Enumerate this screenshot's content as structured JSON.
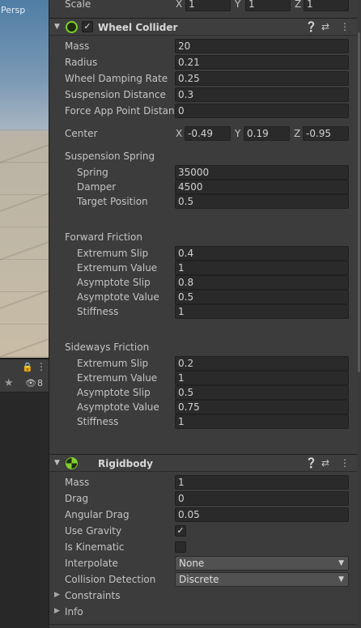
{
  "scene": {
    "view_label": "Persp"
  },
  "left_panel": {
    "visible_count": "8"
  },
  "transform": {
    "scale_label": "Scale",
    "scale": {
      "x_label": "X",
      "x": "1",
      "y_label": "Y",
      "y": "1",
      "z_label": "Z",
      "z": "1"
    }
  },
  "wheel_collider": {
    "title": "Wheel Collider",
    "enabled": true,
    "mass": {
      "label": "Mass",
      "value": "20"
    },
    "radius": {
      "label": "Radius",
      "value": "0.21"
    },
    "wheel_damping_rate": {
      "label": "Wheel Damping Rate",
      "value": "0.25"
    },
    "suspension_distance": {
      "label": "Suspension Distance",
      "value": "0.3"
    },
    "force_app_point_distance": {
      "label": "Force App Point Distanc",
      "value": "0"
    },
    "center": {
      "label": "Center",
      "x_label": "X",
      "x": "-0.49",
      "y_label": "Y",
      "y": "0.19",
      "z_label": "Z",
      "z": "-0.95"
    },
    "suspension_spring": {
      "label": "Suspension Spring",
      "spring": {
        "label": "Spring",
        "value": "35000"
      },
      "damper": {
        "label": "Damper",
        "value": "4500"
      },
      "target_position": {
        "label": "Target Position",
        "value": "0.5"
      }
    },
    "forward_friction": {
      "label": "Forward Friction",
      "extremum_slip": {
        "label": "Extremum Slip",
        "value": "0.4"
      },
      "extremum_value": {
        "label": "Extremum Value",
        "value": "1"
      },
      "asymptote_slip": {
        "label": "Asymptote Slip",
        "value": "0.8"
      },
      "asymptote_value": {
        "label": "Asymptote Value",
        "value": "0.5"
      },
      "stiffness": {
        "label": "Stiffness",
        "value": "1"
      }
    },
    "sideways_friction": {
      "label": "Sideways Friction",
      "extremum_slip": {
        "label": "Extremum Slip",
        "value": "0.2"
      },
      "extremum_value": {
        "label": "Extremum Value",
        "value": "1"
      },
      "asymptote_slip": {
        "label": "Asymptote Slip",
        "value": "0.5"
      },
      "asymptote_value": {
        "label": "Asymptote Value",
        "value": "0.75"
      },
      "stiffness": {
        "label": "Stiffness",
        "value": "1"
      }
    }
  },
  "rigidbody": {
    "title": "Rigidbody",
    "mass": {
      "label": "Mass",
      "value": "1"
    },
    "drag": {
      "label": "Drag",
      "value": "0"
    },
    "angular_drag": {
      "label": "Angular Drag",
      "value": "0.05"
    },
    "use_gravity": {
      "label": "Use Gravity",
      "checked": true
    },
    "is_kinematic": {
      "label": "Is Kinematic",
      "checked": false
    },
    "interpolate": {
      "label": "Interpolate",
      "value": "None"
    },
    "collision_detection": {
      "label": "Collision Detection",
      "value": "Discrete"
    },
    "constraints": {
      "label": "Constraints"
    },
    "info": {
      "label": "Info"
    }
  },
  "icons": {
    "wheel_collider": "wheel-collider-icon",
    "rigidbody": "rigidbody-icon",
    "help": "help-icon",
    "presets": "presets-icon",
    "menu": "kebab-menu-icon",
    "lock": "lock-icon",
    "star": "star-icon",
    "eye": "visibility-icon"
  },
  "colors": {
    "component_icon": "#7fd12a",
    "background": "#3c3c3c",
    "field": "#2a2a2a"
  }
}
